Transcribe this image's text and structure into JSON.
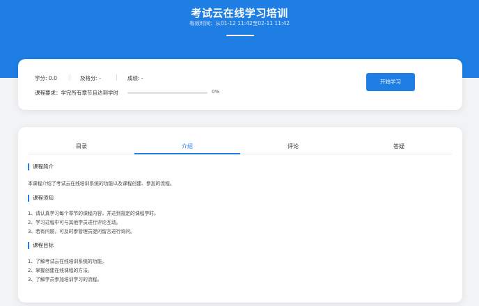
{
  "header": {
    "title": "考试云在线学习培训",
    "validity": "有效时间：从01-12 11:42至02-11 11:42"
  },
  "stats": {
    "credit": "学分: 0.0",
    "pass_score": "及格分: -",
    "score": "成绩: -"
  },
  "requirement": {
    "label": "课程要求：学完所有章节且达到学时",
    "progress_percent": 0,
    "progress_text": "0%"
  },
  "start_button": "开始学习",
  "tabs": [
    {
      "label": "目录",
      "active": false
    },
    {
      "label": "介绍",
      "active": true
    },
    {
      "label": "评论",
      "active": false
    },
    {
      "label": "答疑",
      "active": false
    }
  ],
  "sections": {
    "intro": {
      "title": "课程简介",
      "text": "本课程介绍了考试云在线培训系统的功能以及课程创建、参加的流程。"
    },
    "notice": {
      "title": "课程须知",
      "items": [
        "1、请认真学习每个章节的课程内容，并达到规定的课程学时。",
        "2、学习过程中可与其他学员进行评论互动。",
        "3、若有问题，可及时参管理员提问留言进行询问。"
      ]
    },
    "goals": {
      "title": "课程目标",
      "items": [
        "1、了解考试云在线培训系统的功能。",
        "2、掌握创建在线课程的方法。",
        "3、了解学员参加培训学习的流程。"
      ]
    }
  },
  "colors": {
    "brand": "#1e7ee4",
    "background": "#f2f3f5"
  }
}
